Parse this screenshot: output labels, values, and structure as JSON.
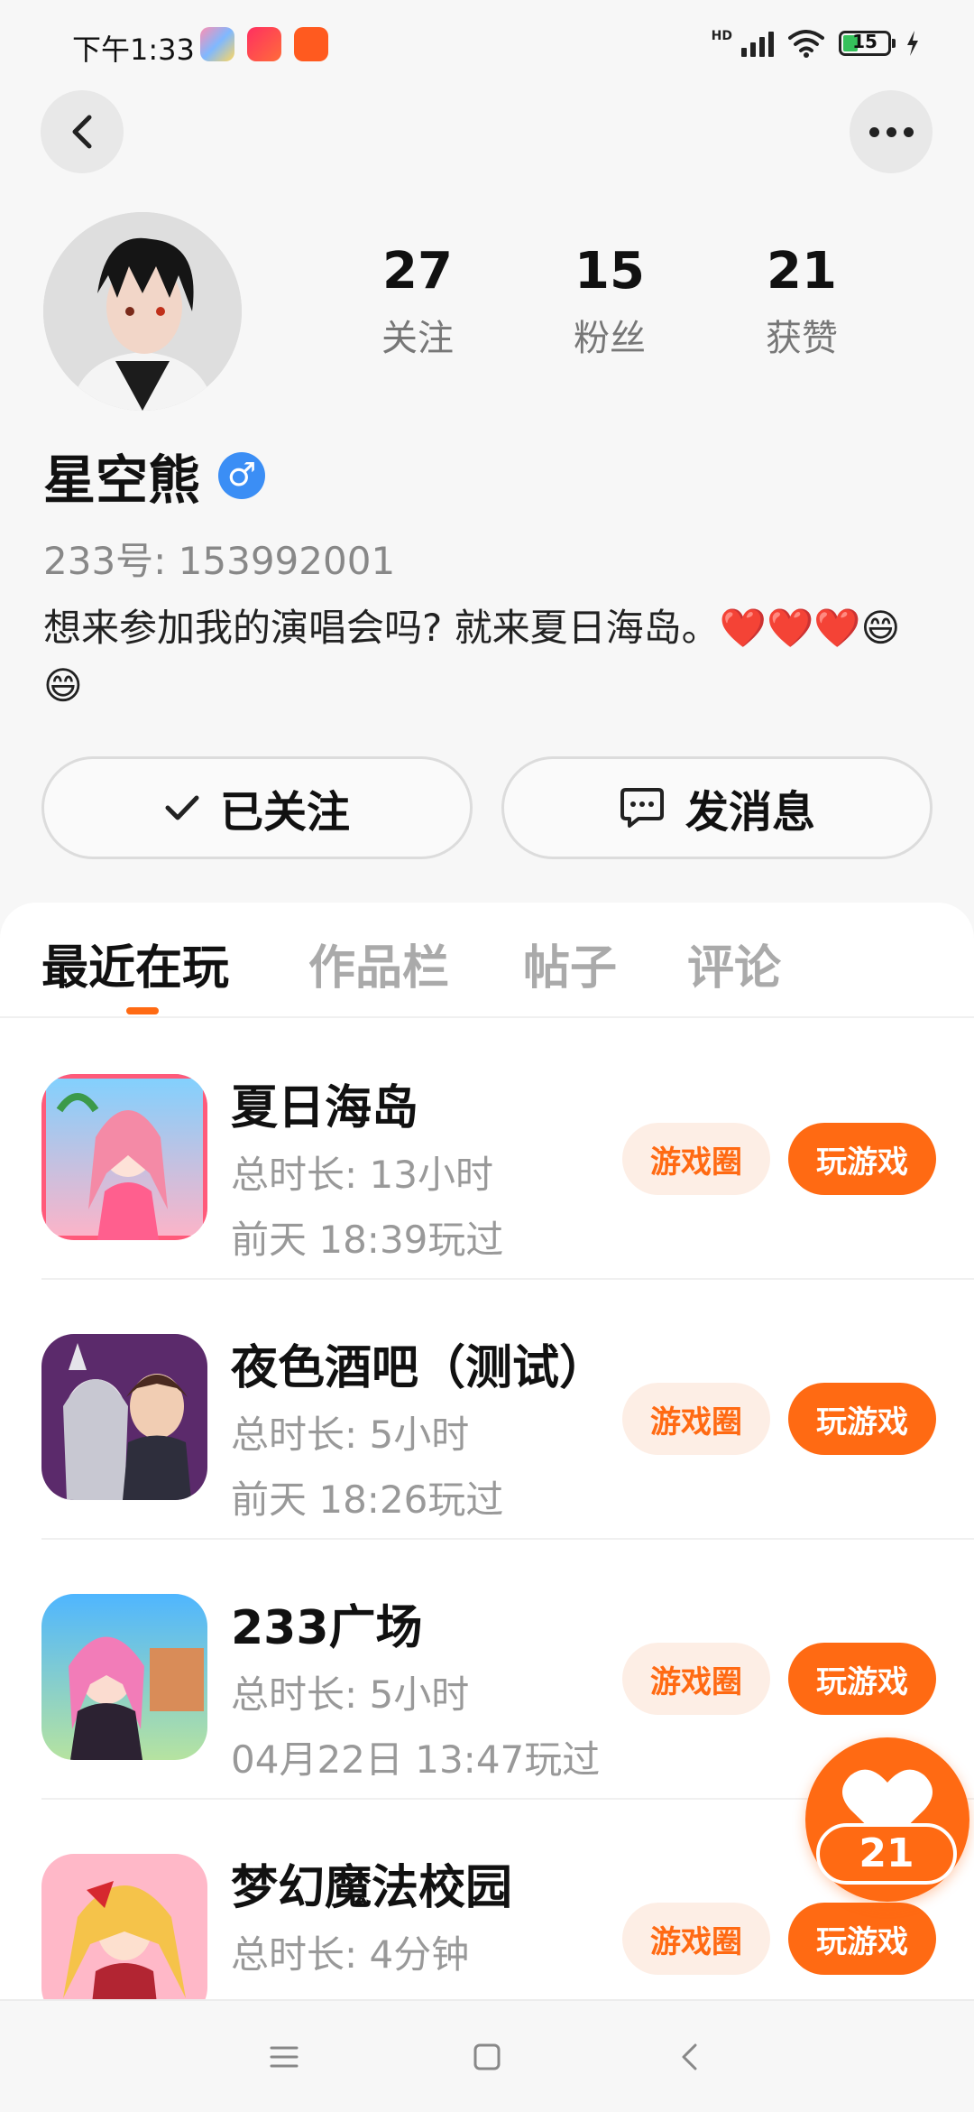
{
  "status_bar": {
    "time": "下午1:33",
    "network_label": "HD",
    "battery_level": "15",
    "apps": [
      "game-center-app-icon",
      "tiktok-app-icon",
      "kuaishou-app-icon"
    ]
  },
  "profile": {
    "stats": [
      {
        "value": "27",
        "label": "关注"
      },
      {
        "value": "15",
        "label": "粉丝"
      },
      {
        "value": "21",
        "label": "获赞"
      }
    ],
    "name": "星空熊",
    "gender_symbol": "♂",
    "uid_text": "233号: 153992001",
    "bio": "想来参加我的演唱会吗? 就来夏日海岛。❤️❤️❤️😄😄"
  },
  "actions": {
    "follow_label": "已关注",
    "message_label": "发消息"
  },
  "tabs": [
    "最近在玩",
    "作品栏",
    "帖子",
    "评论"
  ],
  "active_tab": 0,
  "games": [
    {
      "title": "夏日海岛",
      "duration": "总时长: 13小时",
      "last_played": "前天 18:39玩过",
      "circle_label": "游戏圈",
      "play_label": "玩游戏"
    },
    {
      "title": "夜色酒吧（测试）",
      "duration": "总时长: 5小时",
      "last_played": "前天 18:26玩过",
      "circle_label": "游戏圈",
      "play_label": "玩游戏"
    },
    {
      "title": "233广场",
      "duration": "总时长: 5小时",
      "last_played": "04月22日 13:47玩过",
      "circle_label": "游戏圈",
      "play_label": "玩游戏"
    },
    {
      "title": "梦幻魔法校园",
      "duration": "总时长: 4分钟",
      "last_played": "",
      "circle_label": "游戏圈",
      "play_label": "玩游戏"
    }
  ],
  "like_fab": {
    "count": "21"
  },
  "colors": {
    "accent": "#ff6a13",
    "accent_soft": "#fdeee5",
    "gender_blue": "#3b8ef5",
    "page_bg": "#f7f7f7"
  }
}
